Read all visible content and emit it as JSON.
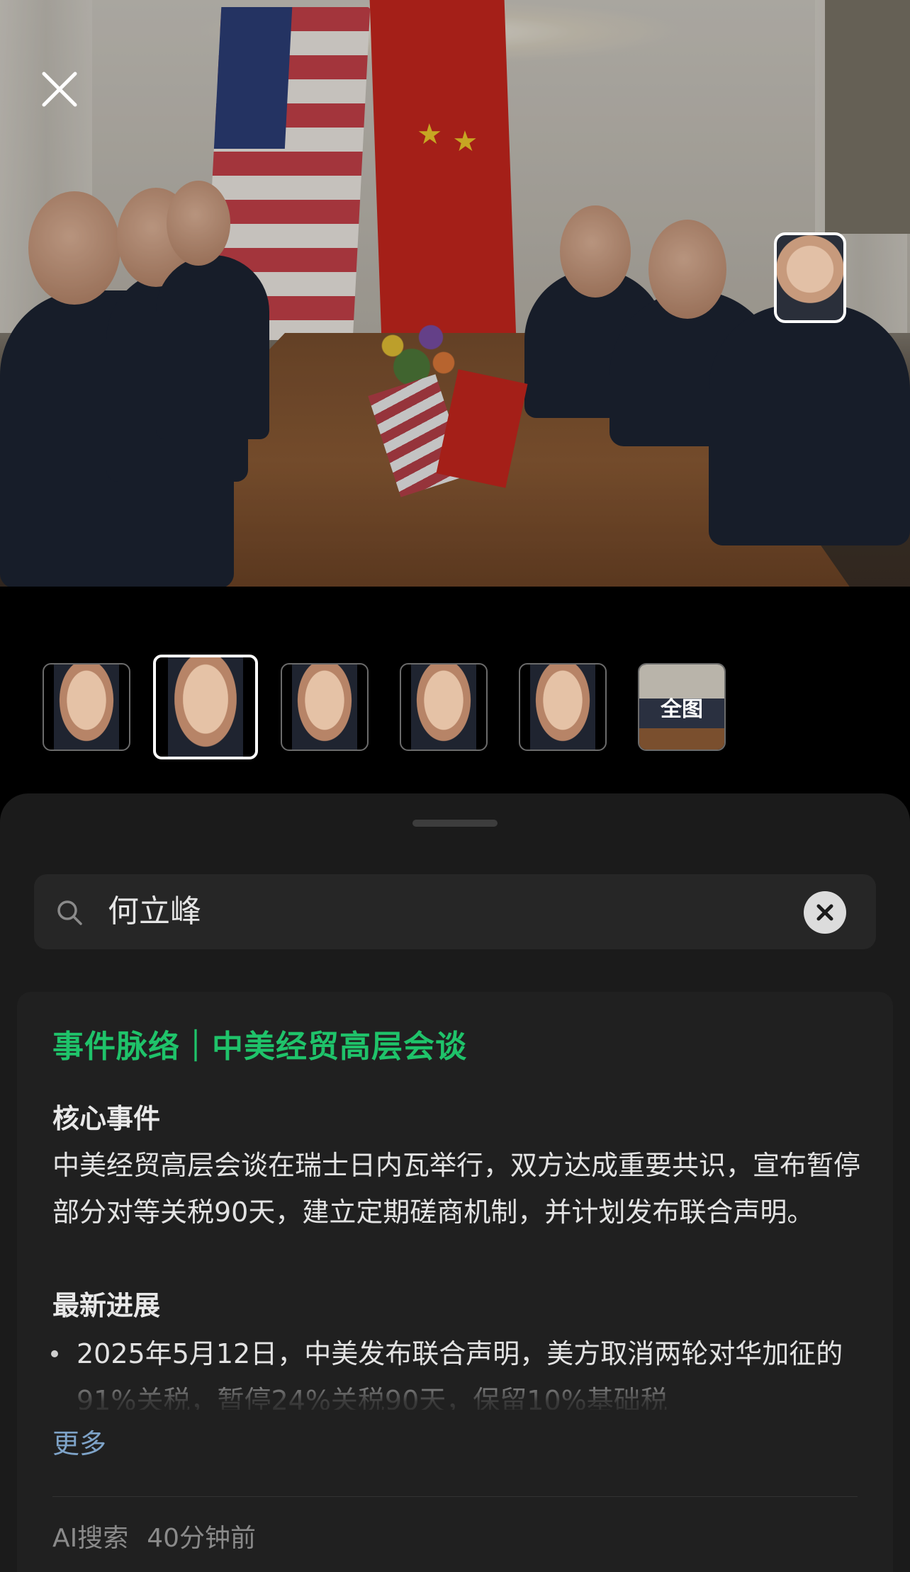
{
  "viewer": {
    "close_icon": "close-icon",
    "thumbnails": [
      {
        "name": "face-1",
        "selected": false
      },
      {
        "name": "face-2",
        "selected": true
      },
      {
        "name": "face-3",
        "selected": false
      },
      {
        "name": "face-4",
        "selected": false
      },
      {
        "name": "face-5",
        "selected": false
      },
      {
        "name": "full-image",
        "label": "全图",
        "selected": false
      }
    ]
  },
  "search": {
    "icon": "search-icon",
    "value": "何立峰",
    "clear_icon": "clear-icon"
  },
  "card": {
    "title": "事件脉络｜中美经贸高层会谈",
    "core_heading": "核心事件",
    "core_text": "中美经贸高层会谈在瑞士日内瓦举行，双方达成重要共识，宣布暂停部分对等关税90天，建立定期磋商机制，并计划发布联合声明。",
    "latest_heading": "最新进展",
    "latest_bullet": "2025年5月12日，中美发布联合声明，美方取消两轮对华加征的91%关税，暂停24%关税90天，保留10%基础税",
    "more_label": "更多",
    "source": "AI搜索",
    "time": "40分钟前"
  },
  "colors": {
    "accent_green": "#1fc36a",
    "link_blue": "#7ea3c8",
    "sheet_bg": "#1b1b1b"
  }
}
